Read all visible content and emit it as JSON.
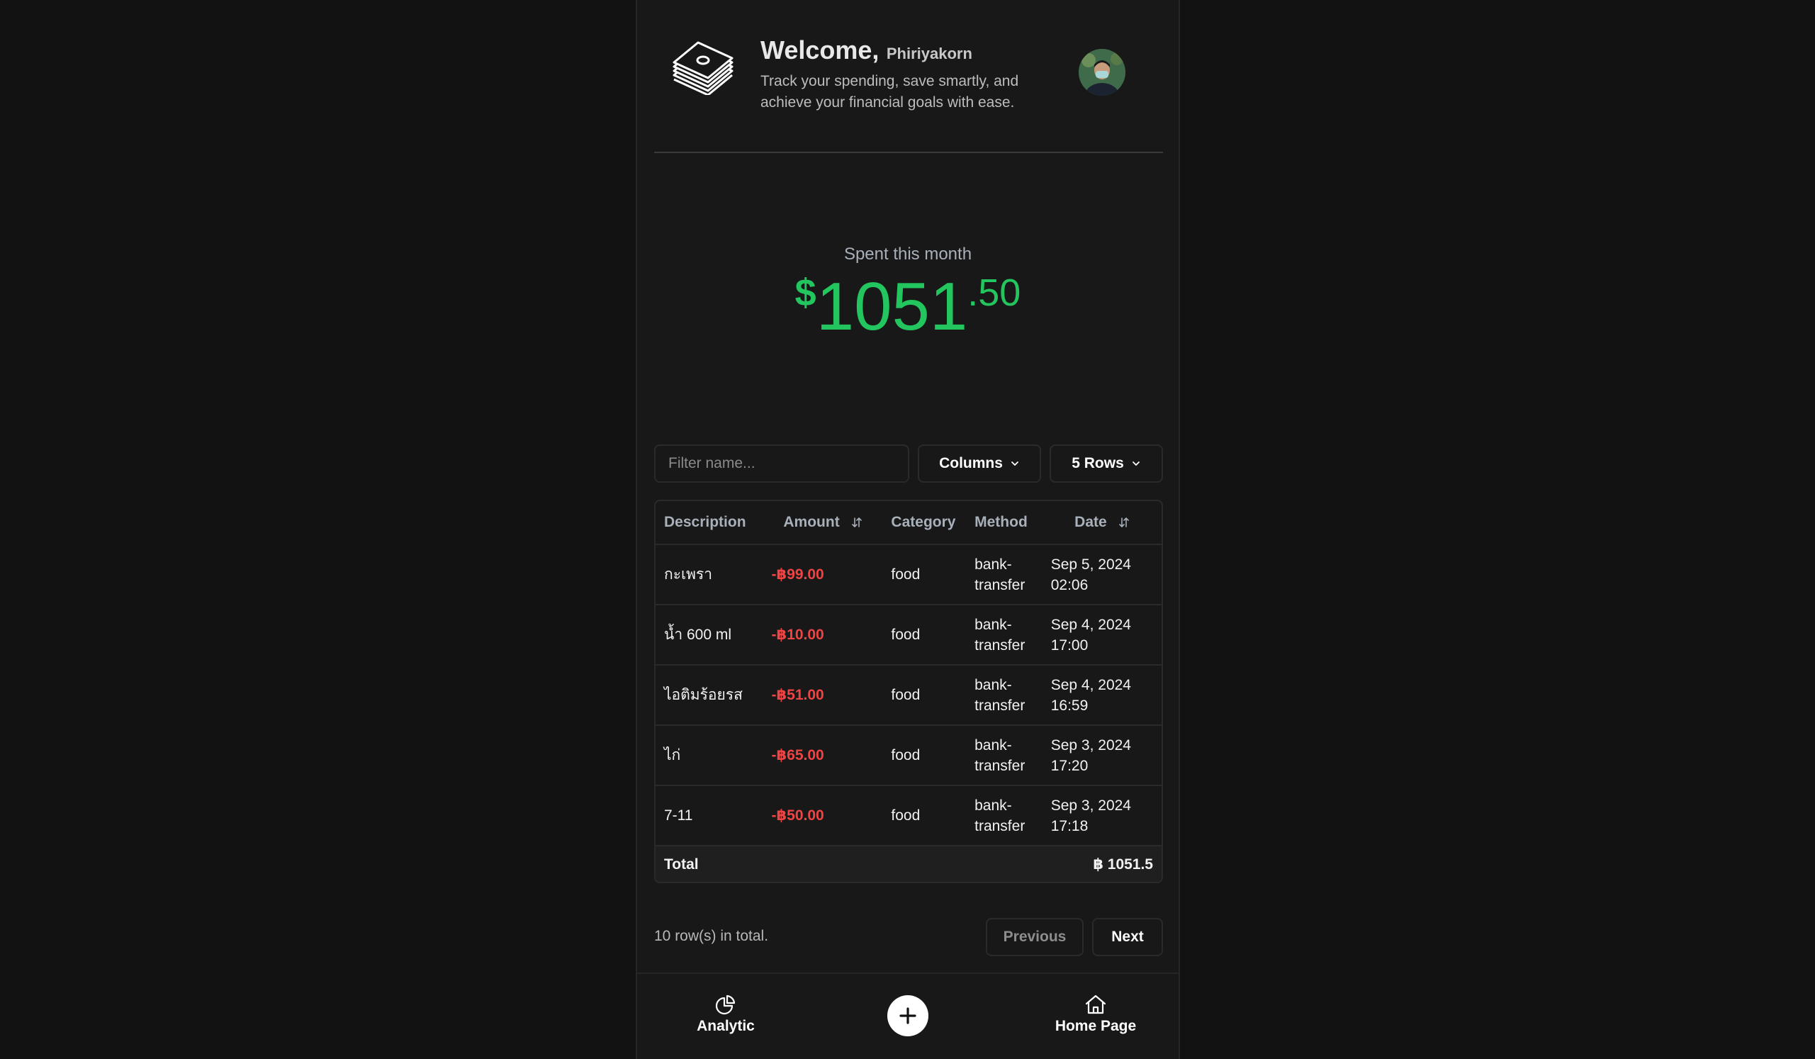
{
  "header": {
    "greeting": "Welcome,",
    "user_name": "Phiriyakorn",
    "tagline": "Track your spending, save smartly, and achieve your financial goals with ease."
  },
  "summary": {
    "label": "Spent this month",
    "currency": "$",
    "whole": "1051",
    "cents": ".50"
  },
  "toolbar": {
    "filter_placeholder": "Filter name...",
    "filter_value": "",
    "columns_label": "Columns",
    "rows_label": "5 Rows"
  },
  "table": {
    "headers": {
      "description": "Description",
      "amount": "Amount",
      "category": "Category",
      "method": "Method",
      "date": "Date"
    },
    "rows": [
      {
        "description": "กะเพรา",
        "amount": "-฿99.00",
        "category": "food",
        "method_1": "bank-",
        "method_2": "transfer",
        "date_1": "Sep 5, 2024",
        "date_2": "02:06"
      },
      {
        "description": "น้ำ 600 ml",
        "amount": "-฿10.00",
        "category": "food",
        "method_1": "bank-",
        "method_2": "transfer",
        "date_1": "Sep 4, 2024",
        "date_2": "17:00"
      },
      {
        "description": "ไอติมร้อยรส",
        "amount": "-฿51.00",
        "category": "food",
        "method_1": "bank-",
        "method_2": "transfer",
        "date_1": "Sep 4, 2024",
        "date_2": "16:59"
      },
      {
        "description": "ไก่",
        "amount": "-฿65.00",
        "category": "food",
        "method_1": "bank-",
        "method_2": "transfer",
        "date_1": "Sep 3, 2024",
        "date_2": "17:20"
      },
      {
        "description": "7-11",
        "amount": "-฿50.00",
        "category": "food",
        "method_1": "bank-",
        "method_2": "transfer",
        "date_1": "Sep 3, 2024",
        "date_2": "17:18"
      }
    ],
    "total_label": "Total",
    "total_value": "฿ 1051.5"
  },
  "pagination": {
    "row_count": "10 row(s) in total.",
    "previous": "Previous",
    "next": "Next"
  },
  "nav": {
    "analytic": "Analytic",
    "home": "Home Page"
  },
  "colors": {
    "accent_green": "#22c55e",
    "expense_red": "#ef4444",
    "background": "#181818"
  },
  "icons": {
    "logo": "money-stack-icon",
    "sort": "sort-arrows-icon",
    "chevron": "chevron-down-icon",
    "analytic": "pie-chart-icon",
    "add": "plus-icon",
    "home": "home-icon"
  }
}
